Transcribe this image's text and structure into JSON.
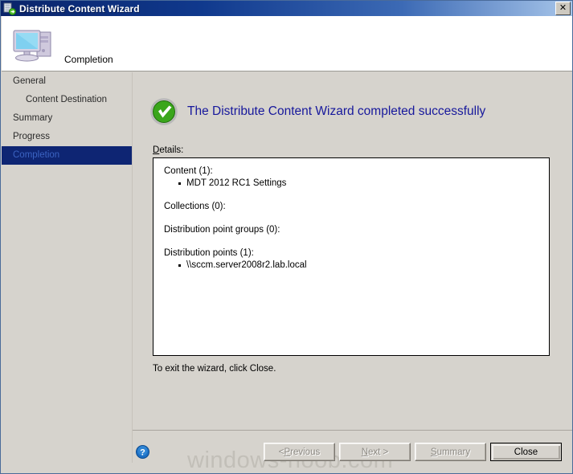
{
  "window": {
    "title": "Distribute Content Wizard",
    "title_icon": "server-distribute-icon",
    "close_label": "✕"
  },
  "banner": {
    "title": "Completion",
    "icon": "computer-monitor-icon"
  },
  "sidebar": {
    "items": [
      {
        "label": "General",
        "sub": false,
        "selected": false
      },
      {
        "label": "Content Destination",
        "sub": true,
        "selected": false
      },
      {
        "label": "Summary",
        "sub": false,
        "selected": false
      },
      {
        "label": "Progress",
        "sub": false,
        "selected": false
      },
      {
        "label": "Completion",
        "sub": false,
        "selected": true
      }
    ]
  },
  "main": {
    "status_icon": "success-check-icon",
    "success_message": "The Distribute Content Wizard completed successfully",
    "details_label_accel": "D",
    "details_label_rest": "etails:",
    "details": [
      {
        "heading": "Content (1):",
        "items": [
          "MDT 2012 RC1 Settings"
        ]
      },
      {
        "heading": "Collections (0):",
        "items": []
      },
      {
        "heading": "Distribution point groups (0):",
        "items": []
      },
      {
        "heading": "Distribution points (1):",
        "items": [
          "\\\\sccm.server2008r2.lab.local"
        ]
      }
    ],
    "exit_note": "To exit the wizard, click Close."
  },
  "footer": {
    "help_icon": "help-question-icon",
    "watermark": "windows-noob.com",
    "buttons": [
      {
        "name": "previous",
        "prefix": "< ",
        "accel": "P",
        "suffix": "revious",
        "disabled": true,
        "default": false
      },
      {
        "name": "next",
        "prefix": "",
        "accel": "N",
        "suffix": "ext >",
        "disabled": true,
        "default": false
      },
      {
        "name": "summary",
        "prefix": "",
        "accel": "S",
        "suffix": "ummary",
        "disabled": true,
        "default": false
      },
      {
        "name": "close",
        "prefix": "",
        "accel": "",
        "suffix": "Close",
        "disabled": false,
        "default": true
      }
    ]
  },
  "colors": {
    "titlebar_start": "#0a246a",
    "titlebar_end": "#a8c6ea",
    "dialog_face": "#d6d3cd",
    "success_text": "#17189c",
    "selection": "#0e2573",
    "success_green": "#3aa61b"
  }
}
